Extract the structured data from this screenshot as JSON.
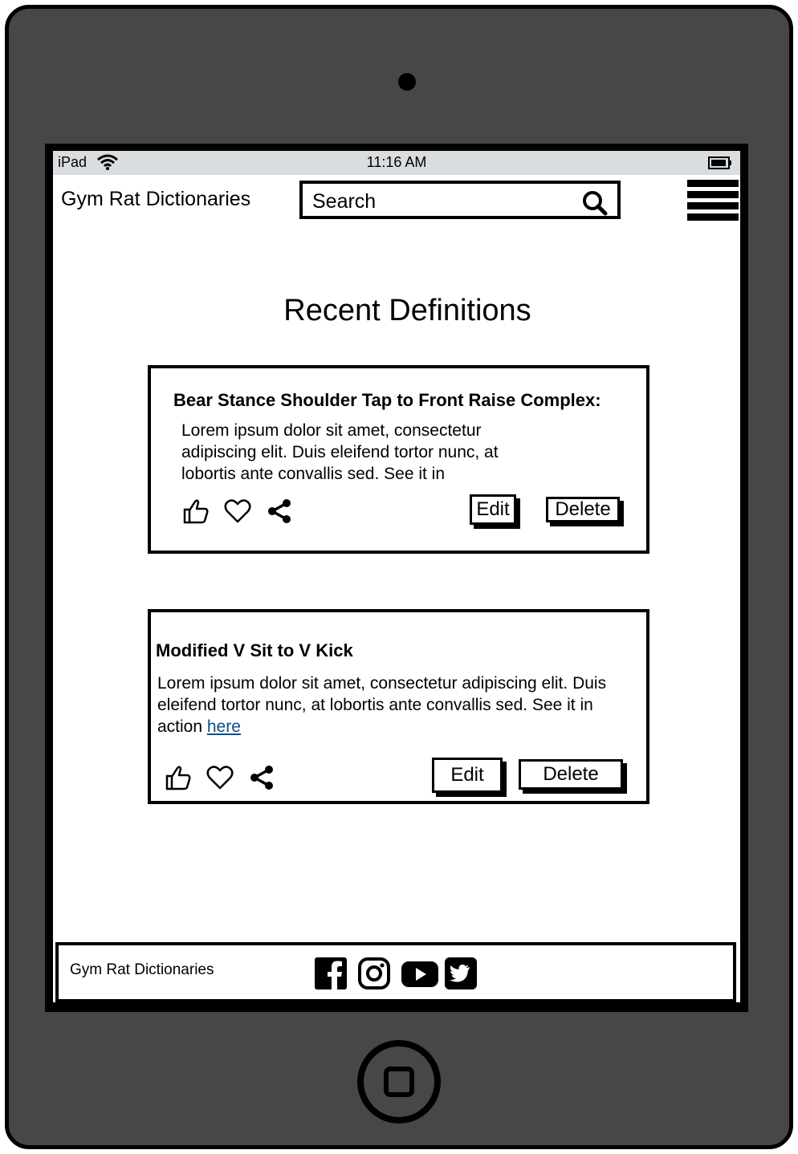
{
  "status_bar": {
    "device": "iPad",
    "time": "11:16 AM"
  },
  "header": {
    "app_title": "Gym Rat Dictionaries",
    "search_placeholder": "Search"
  },
  "main": {
    "title": "Recent Definitions",
    "cards": [
      {
        "title": "Bear Stance Shoulder Tap to Front Raise Complex:",
        "body": "Lorem ipsum dolor sit amet, consectetur adipiscing elit. Duis eleifend tortor nunc, at lobortis ante convallis sed. See it in",
        "edit_label": "Edit",
        "delete_label": "Delete"
      },
      {
        "title": "Modified V Sit to V Kick",
        "body": "Lorem ipsum dolor sit amet, consectetur adipiscing elit. Duis eleifend tortor nunc, at lobortis ante convallis sed. See it in action ",
        "link_text": "here",
        "edit_label": "Edit",
        "delete_label": "Delete"
      }
    ]
  },
  "footer": {
    "title": "Gym Rat Dictionaries",
    "social_icons": [
      "facebook-icon",
      "instagram-icon",
      "youtube-icon",
      "twitter-icon"
    ]
  },
  "colors": {
    "device_body": "#474747",
    "status_bar": "#d9dde0",
    "link": "#0b4f8a"
  }
}
